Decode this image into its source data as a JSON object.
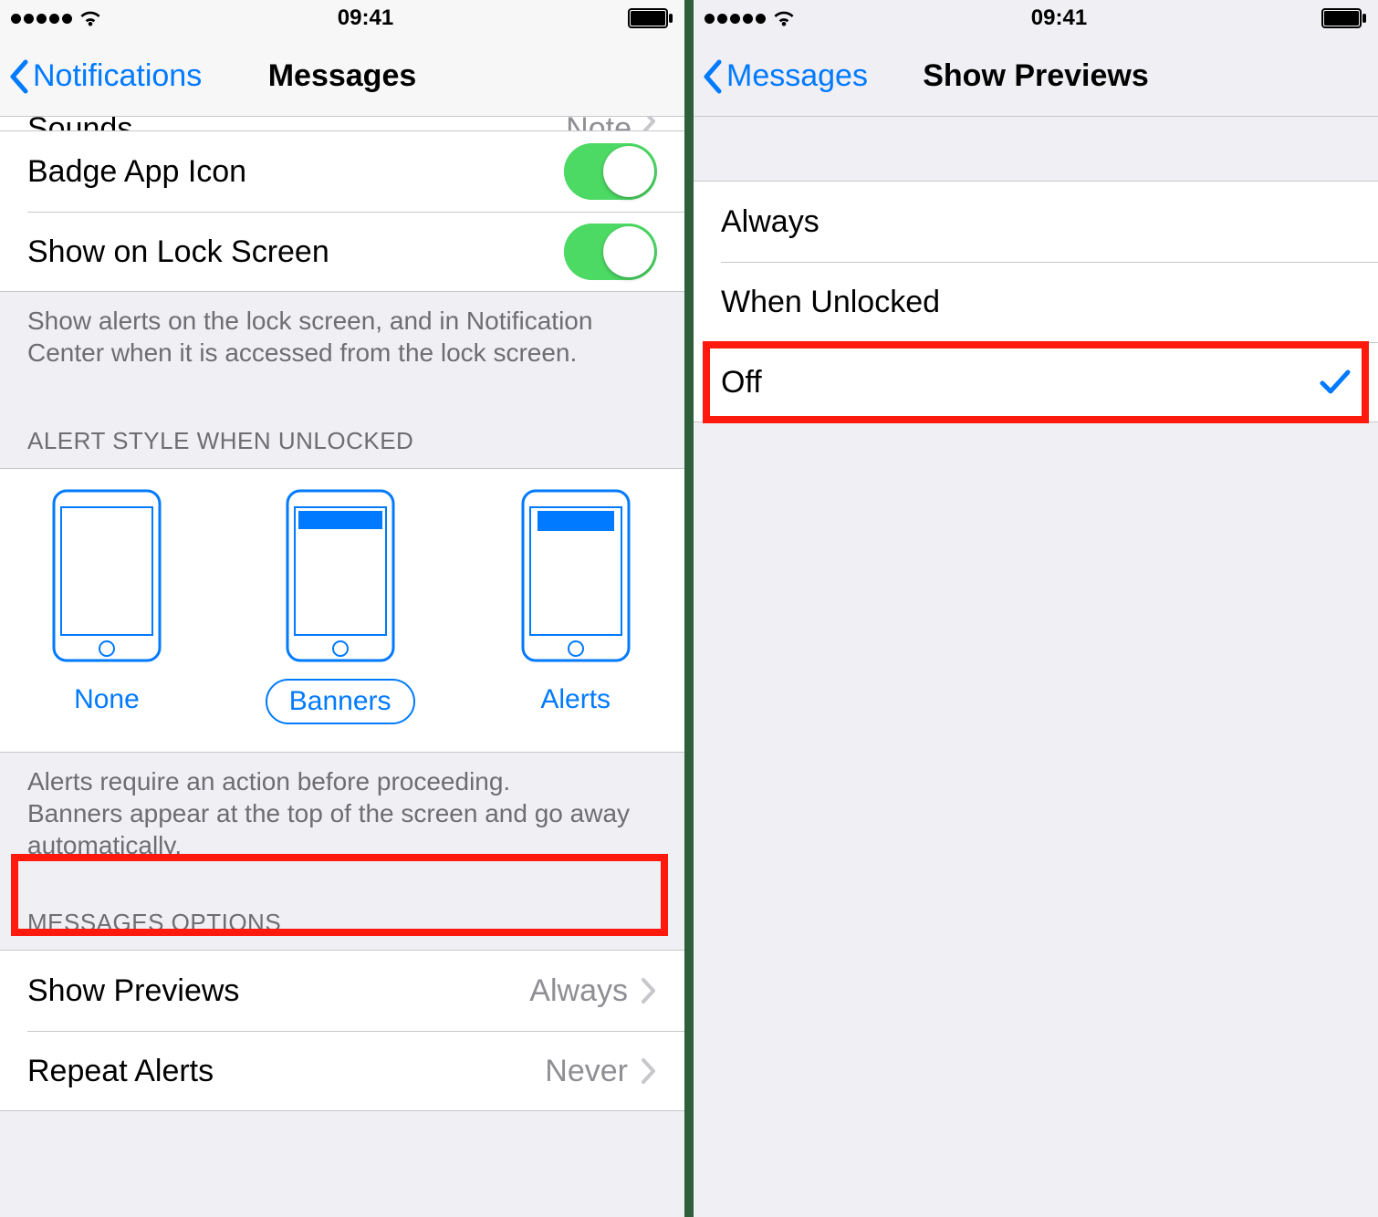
{
  "status": {
    "time": "09:41"
  },
  "left": {
    "back": "Notifications",
    "title": "Messages",
    "partial": {
      "left": "Sounds",
      "right": "Note"
    },
    "rows": {
      "badge": "Badge App Icon",
      "lock": "Show on Lock Screen"
    },
    "footer1": "Show alerts on the lock screen, and in Notification Center when it is accessed from the lock screen.",
    "alertHeader": "ALERT STYLE WHEN UNLOCKED",
    "styles": {
      "none": "None",
      "banners": "Banners",
      "alerts": "Alerts"
    },
    "footer2": "Alerts require an action before proceeding.\nBanners appear at the top of the screen and go away automatically.",
    "optionsHeader": "MESSAGES OPTIONS",
    "showPreviews": {
      "label": "Show Previews",
      "value": "Always"
    },
    "repeatAlerts": {
      "label": "Repeat Alerts",
      "value": "Never"
    }
  },
  "right": {
    "back": "Messages",
    "title": "Show Previews",
    "options": {
      "always": "Always",
      "whenUnlocked": "When Unlocked",
      "off": "Off"
    }
  }
}
